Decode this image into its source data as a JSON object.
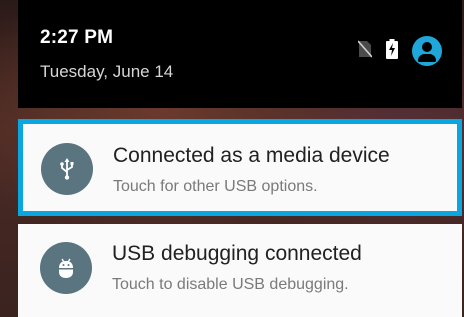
{
  "header": {
    "time": "2:27 PM",
    "date": "Tuesday, June 14",
    "icons": [
      "no-sim-icon",
      "battery-charging-icon",
      "account-icon"
    ]
  },
  "notifications": [
    {
      "icon": "usb-icon",
      "title": "Connected as a media device",
      "text": "Touch for other USB options.",
      "highlighted": true
    },
    {
      "icon": "android-debug-icon",
      "title": "USB debugging connected",
      "text": "Touch to disable USB debugging.",
      "highlighted": false
    }
  ],
  "colors": {
    "highlight": "#0aa6e0",
    "account": "#1ea7d8",
    "notification_icon_bg": "#5a7480"
  }
}
